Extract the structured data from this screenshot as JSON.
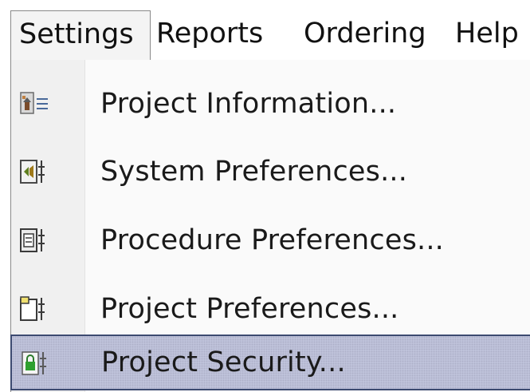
{
  "menubar": {
    "items": [
      {
        "label": "Settings",
        "open": true
      },
      {
        "label": "Reports"
      },
      {
        "label": "Ordering"
      },
      {
        "label": "Help"
      }
    ]
  },
  "dropdown": {
    "items": [
      {
        "label": "Project Information...",
        "icon": "project-information-icon"
      },
      {
        "label": "System Preferences...",
        "icon": "system-preferences-icon"
      },
      {
        "label": "Procedure Preferences...",
        "icon": "procedure-preferences-icon"
      },
      {
        "label": "Project Preferences...",
        "icon": "project-preferences-icon"
      },
      {
        "label": "Project Security...",
        "icon": "project-security-icon",
        "selected": true
      }
    ]
  },
  "colors": {
    "selection_fill": "#c2c6dd",
    "selection_border": "#3c4a70",
    "menu_border": "#8a8a8a"
  }
}
